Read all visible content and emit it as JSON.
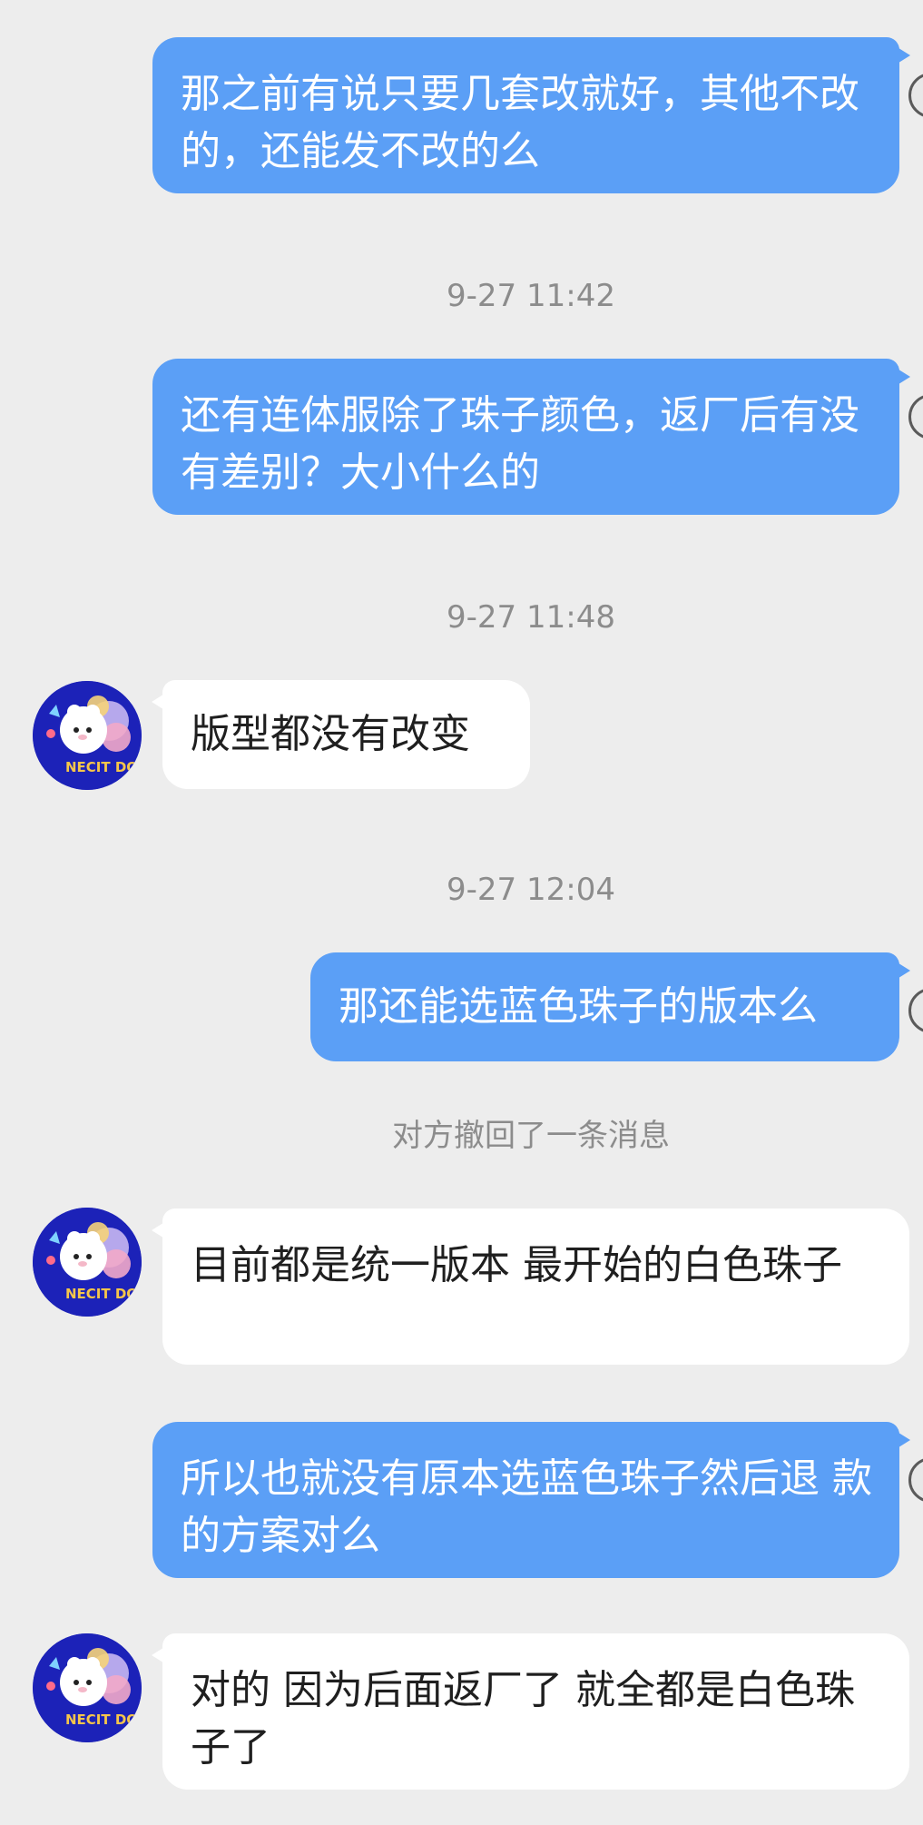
{
  "messages": [
    {
      "text": "那之前有说只要几套改就好，其他不改的，还能发不改的么"
    },
    {
      "text": "9-27 11:42"
    },
    {
      "text": "还有连体服除了珠子颜色，返厂后有没有差别？大小什么的"
    },
    {
      "text": "9-27 11:48"
    },
    {
      "text": "版型都没有改变"
    },
    {
      "text": "9-27 12:04"
    },
    {
      "text": "那还能选蓝色珠子的版本么"
    },
    {
      "text": "对方撤回了一条消息"
    },
    {
      "text": "目前都是统一版本 最开始的白色珠子"
    },
    {
      "text": "所以也就没有原本选蓝色珠子然后退 款的方案对么"
    },
    {
      "text": "对的 因为后面返厂了 就全都是白色珠子了"
    }
  ],
  "avatar": {
    "label": "NECIT DOLL"
  },
  "colors": {
    "background": "#ededed",
    "outgoing_bubble": "#5b9ff6",
    "incoming_bubble": "#ffffff",
    "timestamp_text": "#8c8c8c"
  }
}
